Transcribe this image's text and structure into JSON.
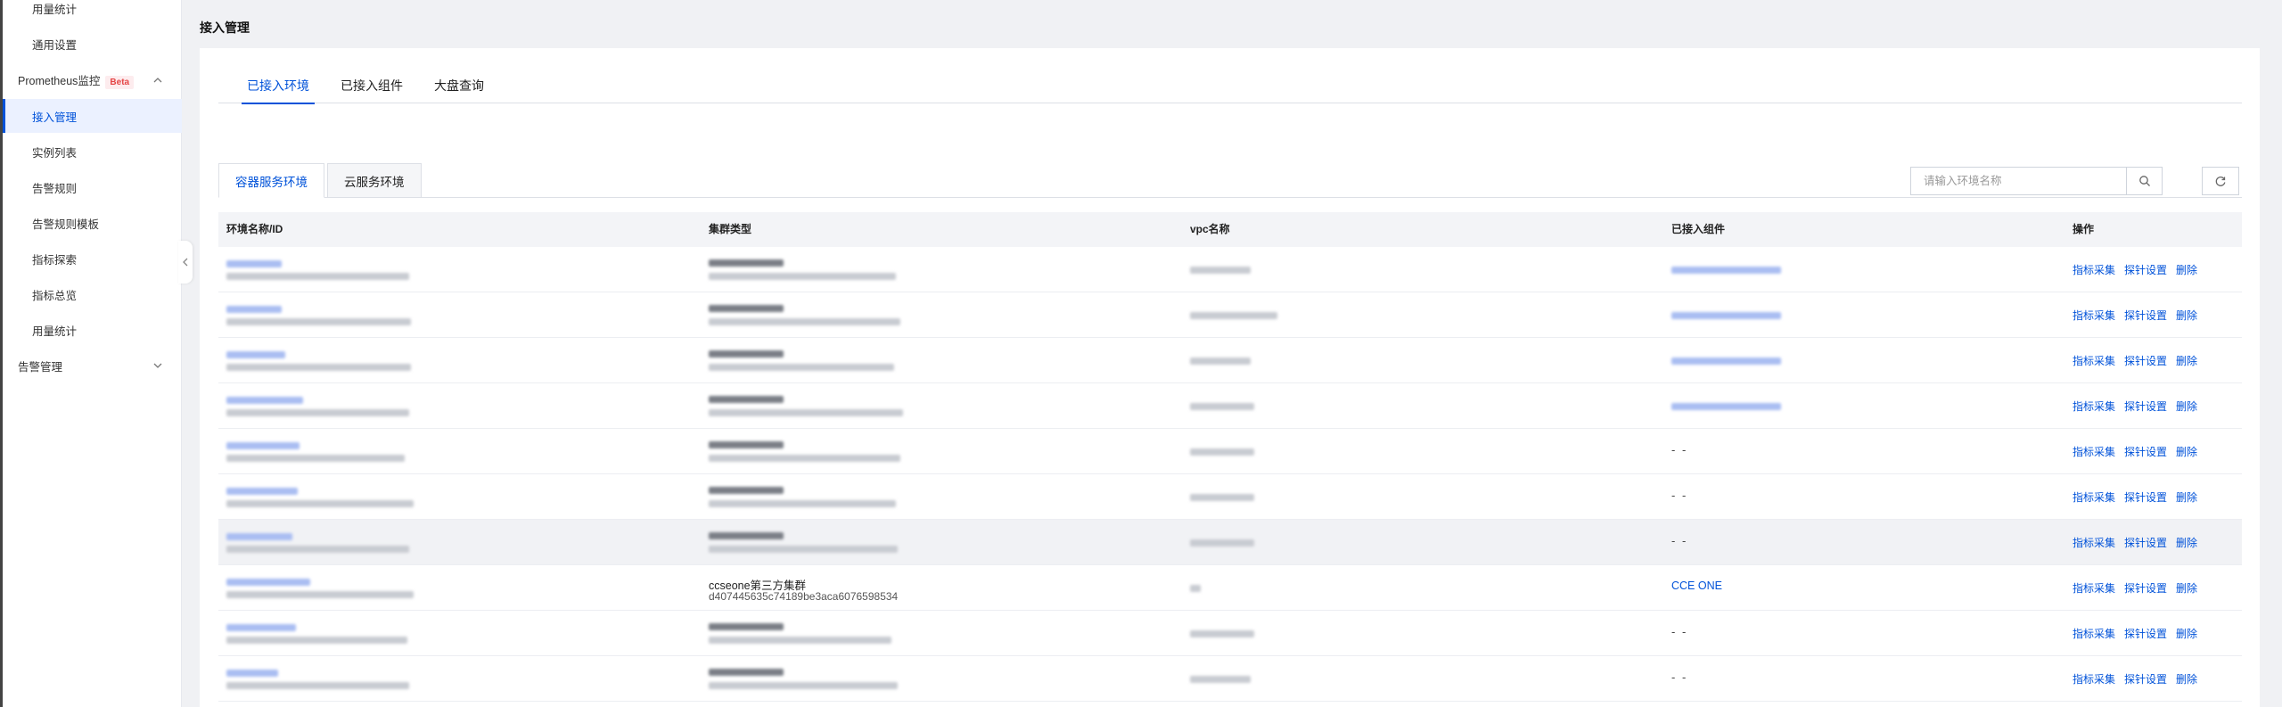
{
  "sidebar": {
    "items": [
      {
        "label": "用量统计",
        "kind": "sub"
      },
      {
        "label": "通用设置",
        "kind": "sub"
      },
      {
        "label": "Prometheus监控",
        "kind": "group",
        "badge": "Beta",
        "expanded": true
      },
      {
        "label": "接入管理",
        "kind": "sub",
        "active": true
      },
      {
        "label": "实例列表",
        "kind": "sub"
      },
      {
        "label": "告警规则",
        "kind": "sub"
      },
      {
        "label": "告警规则模板",
        "kind": "sub"
      },
      {
        "label": "指标探索",
        "kind": "sub"
      },
      {
        "label": "指标总览",
        "kind": "sub"
      },
      {
        "label": "用量统计",
        "kind": "sub"
      },
      {
        "label": "告警管理",
        "kind": "group",
        "expanded": false
      }
    ]
  },
  "page": {
    "title": "接入管理"
  },
  "tabs": [
    {
      "label": "已接入环境",
      "active": true
    },
    {
      "label": "已接入组件",
      "active": false
    },
    {
      "label": "大盘查询",
      "active": false
    }
  ],
  "subtabs": [
    {
      "label": "容器服务环境",
      "active": true
    },
    {
      "label": "云服务环境",
      "active": false
    }
  ],
  "search": {
    "placeholder": "请输入环境名称",
    "value": ""
  },
  "table": {
    "columns": [
      "环境名称/ID",
      "集群类型",
      "vpc名称",
      "已接入组件",
      "操作"
    ],
    "operations": [
      "指标采集",
      "探针设置",
      "删除"
    ],
    "special_row": {
      "cluster_type": "ccseone第三方集群",
      "cluster_id": "d407445635c74189be3aca6076598534",
      "component": "CCE ONE"
    },
    "empty_placeholder": "- -"
  },
  "colors": {
    "accent": "#0052d9",
    "badge": "#e54545"
  }
}
